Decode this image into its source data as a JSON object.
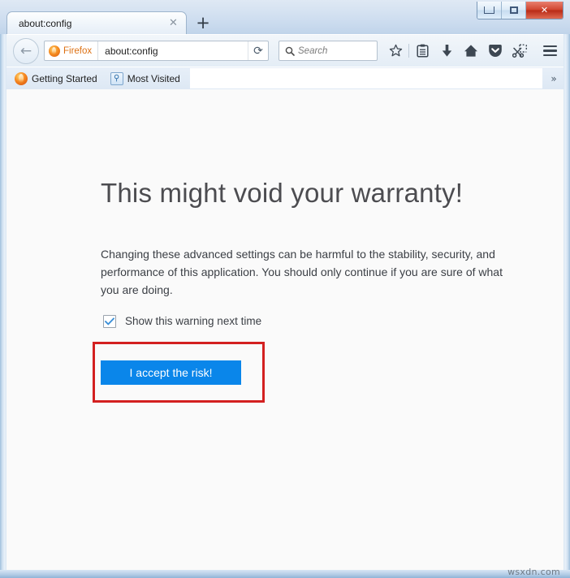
{
  "window": {
    "caption_buttons": [
      {
        "name": "minimize",
        "glyph": "—"
      },
      {
        "name": "maximize",
        "glyph": "□"
      },
      {
        "name": "close",
        "glyph": "✕"
      }
    ]
  },
  "tabs": {
    "active_tab_title": "about:config",
    "close_glyph": "✕",
    "new_tab_glyph": "+"
  },
  "toolbar": {
    "back_glyph": "←",
    "identity_label": "Firefox",
    "url_value": "about:config",
    "reload_glyph": "⟳",
    "search_placeholder": "Search",
    "icons": [
      {
        "name": "bookmark-star-icon",
        "glyph": "☆"
      },
      {
        "name": "reader-list-icon",
        "glyph": "☷"
      },
      {
        "name": "downloads-icon",
        "glyph": "⬇"
      },
      {
        "name": "home-icon",
        "glyph": "⌂"
      },
      {
        "name": "pocket-icon",
        "glyph": "▼"
      },
      {
        "name": "screenshot-scissors-icon",
        "glyph": "✂"
      }
    ],
    "menu_label": "Open menu"
  },
  "bookmarks": {
    "items": [
      {
        "label": "Getting Started",
        "icon": "firefox-logo-icon"
      },
      {
        "label": "Most Visited",
        "icon": "most-visited-icon"
      }
    ],
    "most_visited_glyph": "⚲",
    "overflow_glyph": "»"
  },
  "page": {
    "title": "This might void your warranty!",
    "body": "Changing these advanced settings can be harmful to the stability, security, and performance of this application. You should only continue if you are sure of what you are doing.",
    "checkbox_label": "Show this warning next time",
    "checkbox_checked": true,
    "accept_button_label": "I accept the risk!"
  },
  "annotation": {
    "highlight_color": "#d32020"
  },
  "watermark": "wsxdn.com",
  "colors": {
    "button_blue": "#0a86ea",
    "checkbox_check_blue": "#3b8fd8",
    "identity_orange": "#dd7012",
    "annotation_red": "#d32020",
    "page_background": "#fafafa"
  }
}
